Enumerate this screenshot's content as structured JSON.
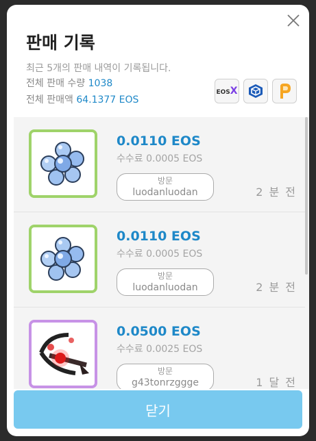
{
  "modal": {
    "title": "판매 기록",
    "subtitle": "최근 5개의 판매 내역이 기록됩니다.",
    "stats": [
      {
        "label": "전체 판매 수량",
        "value": "1038"
      },
      {
        "label": "전체 판매액",
        "value": "64.1377 EOS"
      }
    ],
    "badges": [
      {
        "name": "eosx",
        "text": "EOS",
        "mark": "X"
      },
      {
        "name": "bloks-cube"
      },
      {
        "name": "eosflare-p"
      }
    ],
    "close_label": "닫기"
  },
  "records": [
    {
      "price": "0.0110 EOS",
      "fee": "수수료 0.0005 EOS",
      "visit_label": "방문",
      "user": "luodanluodan",
      "time": "2 분 전",
      "border": "green",
      "item": "ice-crystal-icon"
    },
    {
      "price": "0.0110 EOS",
      "fee": "수수료 0.0005 EOS",
      "visit_label": "방문",
      "user": "luodanluodan",
      "time": "2 분 전",
      "border": "green",
      "item": "ice-crystal-icon"
    },
    {
      "price": "0.0500 EOS",
      "fee": "수수료 0.0025 EOS",
      "visit_label": "방문",
      "user": "g43tonrzggge",
      "time": "1 달 전",
      "border": "purple",
      "item": "crossbow-icon"
    }
  ],
  "colors": {
    "accent": "#1e88c8",
    "button": "#78c9ef",
    "green_border": "#9fd36a",
    "purple_border": "#c792e6"
  }
}
